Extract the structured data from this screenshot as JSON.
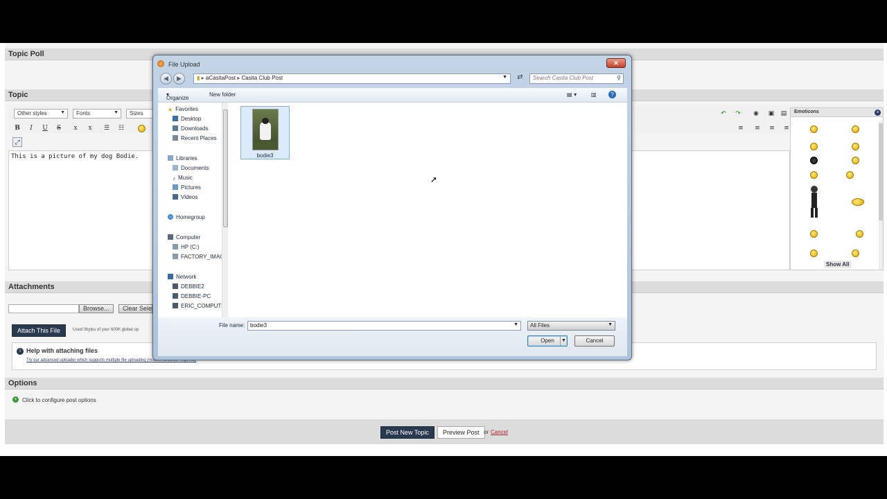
{
  "forum": {
    "topic_poll": "Topic Poll",
    "topic": "Topic",
    "editor": {
      "styles_select": "Other styles",
      "fonts_select": "Fonts",
      "sizes_select": "Sizes",
      "bold": "B",
      "italic": "I",
      "underline": "U",
      "strike": "S",
      "subscript": "x",
      "superscript": "x",
      "body_text": "This is a picture of my dog Bodie."
    },
    "emoticons": {
      "title": "Emoticons",
      "show_all": "Show All"
    },
    "attachments": {
      "header": "Attachments",
      "browse": "Browse...",
      "clear": "Clear Selection",
      "attach_button": "Attach This File",
      "usage": "Used 0bytes of your 600K global up",
      "help_title": "Help with attaching files",
      "help_link": "Try our advanced uploader which supports multiple file uploading (modern browser required)"
    },
    "options": {
      "header": "Options",
      "configure": "Click to configure post options"
    },
    "footer": {
      "post_new_topic": "Post New Topic",
      "preview_post": "Preview Post",
      "or": "or",
      "cancel": "Cancel"
    }
  },
  "dialog": {
    "title": "File Upload",
    "breadcrumb": [
      "aCasitaPost",
      "Casita Club Post"
    ],
    "search_placeholder": "Search Casita Club Post",
    "organize": "Organize",
    "new_folder": "New folder",
    "nav": {
      "favorites": "Favorites",
      "favorites_items": [
        "Desktop",
        "Downloads",
        "Recent Places"
      ],
      "libraries": "Libraries",
      "libraries_items": [
        "Documents",
        "Music",
        "Pictures",
        "Videos"
      ],
      "homegroup": "Homegroup",
      "computer": "Computer",
      "computer_items": [
        "HP (C:)",
        "FACTORY_IMAGE"
      ],
      "network": "Network",
      "network_items": [
        "DEBBIE2",
        "DEBBIE-PC",
        "ERIC_COMPUTER"
      ]
    },
    "file": {
      "name": "bodie3"
    },
    "file_name_label": "File name:",
    "file_name_value": "bodie3",
    "filter": "All Files",
    "open": "Open",
    "cancel": "Cancel"
  },
  "colors": {
    "dark_button": "#2a3a4e",
    "dialog_frame": "#aec3dc",
    "selection": "#dcebfc"
  }
}
